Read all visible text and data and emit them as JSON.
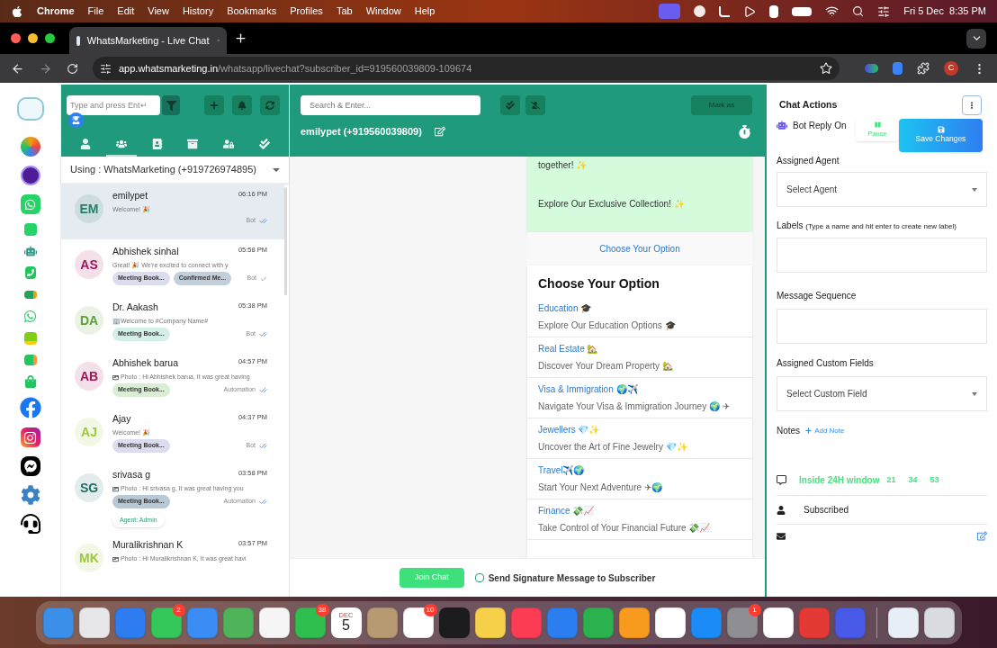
{
  "menubar": {
    "app": "Chrome",
    "menus": [
      "File",
      "Edit",
      "View",
      "History",
      "Bookmarks",
      "Profiles",
      "Tab",
      "Window",
      "Help"
    ],
    "clock": "Fri 5 Dec  8:35 PM"
  },
  "browser": {
    "tab_title": "WhatsMarketing - Live Chat",
    "url_host": "app.whatsmarketing.in",
    "url_path": "/whatsapp/livechat?subscriber_id=919560039809-109674",
    "profile": "C"
  },
  "chat_list": {
    "search_placeholder": "Type and press Ent↵",
    "tabs": [
      {
        "kind": "person",
        "selected": false
      },
      {
        "kind": "group",
        "selected": true
      },
      {
        "kind": "book",
        "selected": false
      },
      {
        "kind": "archive",
        "selected": false
      },
      {
        "kind": "lock",
        "selected": false
      },
      {
        "kind": "done",
        "selected": false
      }
    ],
    "account": "Using : WhatsMarketing (+919726974895)",
    "chats": [
      {
        "initials": "EM",
        "color": "#23806c",
        "name": "emilypet",
        "time": "06:16 PM",
        "preview": "Welcome! 🎉",
        "sender": "Bot",
        "double_tick": true,
        "selected": true
      },
      {
        "initials": "AS",
        "color": "#a3145a",
        "name": "Abhishek sinhal",
        "time": "05:58 PM",
        "preview": "Great! 🎉 We're excited to connect with y",
        "sender": "Bot",
        "double_tick": false,
        "selected": false,
        "labels": [
          {
            "text": "Meeting Book...",
            "color": "#dcdcef"
          },
          {
            "text": "Confirmed Me...",
            "color": "#c3cedb"
          }
        ]
      },
      {
        "initials": "DA",
        "color": "#5f9e3a",
        "name": "Dr. Aakash",
        "time": "05:38 PM",
        "preview": "🏢Welcome to #Company Name#",
        "sender": "Bot",
        "double_tick": true,
        "selected": false,
        "labels": [
          {
            "text": "Meeting Book...",
            "color": "#d3efe8"
          }
        ]
      },
      {
        "initials": "AB",
        "color": "#a3145a",
        "name": "Abhishek barua",
        "time": "04:57 PM",
        "attachment": true,
        "preview": "Photo : Hi Abhishek barua, It was great having",
        "sender": "Automation",
        "double_tick": true,
        "selected": false,
        "labels": [
          {
            "text": "Meeting Book...",
            "color": "#daeed5"
          }
        ]
      },
      {
        "initials": "AJ",
        "color": "#9cc83c",
        "name": "Ajay",
        "time": "04:37 PM",
        "preview": "Welcome! 🎉",
        "sender": "Bot",
        "double_tick": true,
        "selected": false,
        "labels": [
          {
            "text": "Meeting Book...",
            "color": "#dcdcef"
          }
        ]
      },
      {
        "initials": "SG",
        "color": "#1f6d66",
        "name": "srivasa g",
        "time": "03:58 PM",
        "attachment": true,
        "preview": "Photo : Hi srivasa g, It was great having you",
        "sender": "Automation",
        "double_tick": true,
        "selected": false,
        "labels": [
          {
            "text": "Meeting Book...",
            "color": "#b9c8d5"
          }
        ],
        "agent": "Agent: Admin"
      },
      {
        "initials": "MK",
        "color": "#9cc83c",
        "name": "Muralikrishnan K",
        "time": "03:57 PM",
        "attachment": true,
        "preview": "Photo : Hi Muralikrishnan K, It was great havi",
        "selected": false
      }
    ]
  },
  "chat": {
    "search_placeholder": "Search & Enter...",
    "mark_as": "Mark as",
    "contact": "emilypet (+919560039809)",
    "bubble": [
      "together! ✨",
      "Explore Our Exclusive Collection! ✨"
    ],
    "list_button": "Choose Your Option",
    "list": {
      "title": "Choose Your Option",
      "options": [
        {
          "title": "Education 🎓",
          "description": "Explore Our Education Options 🎓"
        },
        {
          "title": "Real Estate 🏡",
          "description": "Discover Your Dream Property 🏡"
        },
        {
          "title": "Visa & Immigration 🌍✈️",
          "description": "Navigate Your Visa & Immigration Journey 🌍 ✈"
        },
        {
          "title": "Jewellers 💎✨",
          "description": "Uncover the Art of Fine Jewelry 💎✨"
        },
        {
          "title": "Travel✈️🌍",
          "description": "Start Your Next Adventure ✈🌍"
        },
        {
          "title": "Finance 💸📈",
          "description": "Take Control of Your Financial Future 💸📈"
        }
      ]
    },
    "join": "Join Chat",
    "signature": {
      "label": "Send Signature Message to Subscriber",
      "checked": false
    }
  },
  "actions": {
    "title": "Chat Actions",
    "bot_reply": "Bot Reply On",
    "pause": "Pause",
    "save": "Save Changes",
    "agent": {
      "label": "Assigned Agent",
      "placeholder": "Select Agent"
    },
    "labels": {
      "label": "Labels",
      "hint": "(Type a name and hit enter to create new label)"
    },
    "sequence": {
      "label": "Message Sequence"
    },
    "custom": {
      "label": "Assigned Custom Fields",
      "placeholder": "Select Custom Field"
    },
    "notes": {
      "label": "Notes",
      "add": "Add Note"
    },
    "window": {
      "label": "Inside 24H window",
      "counts": [
        "21",
        "34",
        "53"
      ]
    },
    "status": "Subscribed"
  },
  "dock": [
    {
      "kind": "app"
    },
    {
      "kind": "app"
    },
    {
      "kind": "app"
    },
    {
      "kind": "app",
      "badge": "2"
    },
    {
      "kind": "app"
    },
    {
      "kind": "app"
    },
    {
      "kind": "app"
    },
    {
      "kind": "app",
      "badge": "38"
    },
    {
      "kind": "calendar",
      "month": "DEC",
      "day": "5"
    },
    {
      "kind": "app"
    },
    {
      "kind": "app",
      "badge": "10"
    },
    {
      "kind": "app"
    },
    {
      "kind": "app"
    },
    {
      "kind": "app"
    },
    {
      "kind": "app"
    },
    {
      "kind": "app"
    },
    {
      "kind": "app"
    },
    {
      "kind": "app"
    },
    {
      "kind": "app"
    },
    {
      "kind": "app",
      "badge": "1"
    },
    {
      "kind": "app"
    },
    {
      "kind": "app"
    },
    {
      "kind": "app"
    },
    {
      "kind": "app"
    },
    {
      "kind": "app"
    }
  ]
}
